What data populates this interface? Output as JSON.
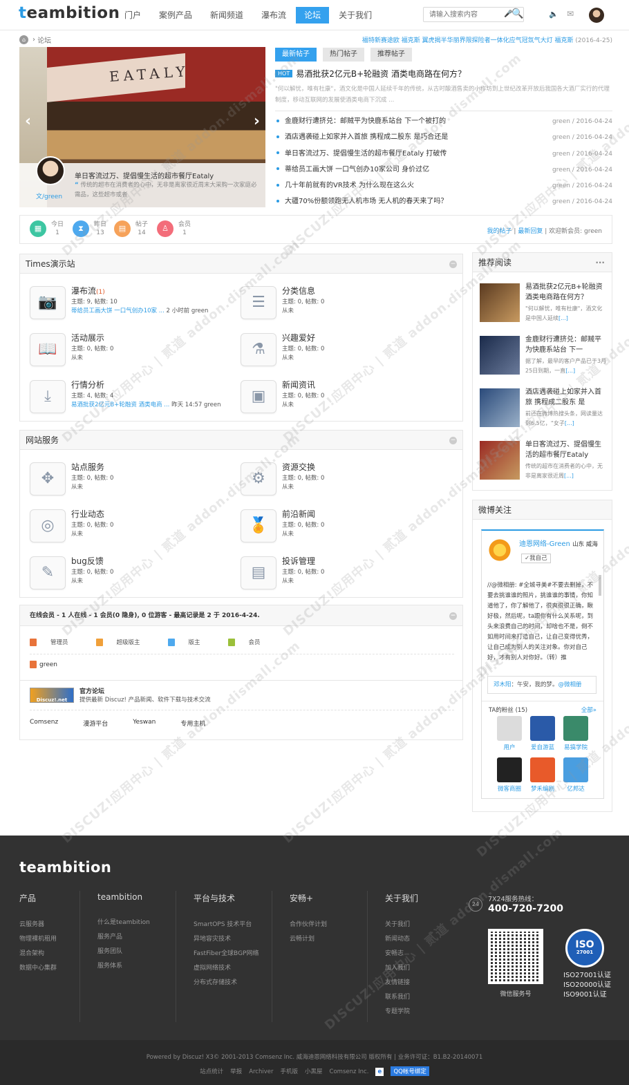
{
  "header": {
    "logo_first": "t",
    "logo_rest": "eambition",
    "nav": [
      "门户",
      "案例产品",
      "新闻频道",
      "瀑布流",
      "论坛",
      "关于我们"
    ],
    "active_nav": 4,
    "search_placeholder": "请输入搜索内容"
  },
  "breadcrumb": {
    "current": "论坛"
  },
  "ticker": {
    "text": "福特新赛途欧 福克斯 翼虎揭半华丽界限探险者一体化应气冠氛气大灯 福克斯",
    "date": "(2016-4-25)"
  },
  "slider": {
    "sign": "EATALY",
    "title": "单日客流过万、提倡慢生活的超市餐厅Eataly",
    "desc": "传统的超市在消费者的心中，无非是离家很近周末大采购一次家庭必需品，这些超市或者",
    "author": "文/green"
  },
  "post_tabs": [
    "最新帖子",
    "热门帖子",
    "推荐帖子"
  ],
  "hot_post": {
    "badge": "HOT",
    "title": "易酒批获2亿元B+轮融资 酒类电商路在何方？",
    "desc": "\"何以解忧，唯有杜康\"，酒文化是中国人延续千年的传统，从古时酿酒售卖的小作坊到上世纪改革开放后我国各大酒厂实行的代理制度，移动互联网的发展使酒类电商下沉成 ..."
  },
  "posts": [
    {
      "title": "金鹿财行遭挤兑：邮贼平为快鹿系站台 下一个被打的",
      "meta": "green / 2016-04-24"
    },
    {
      "title": "酒店遇袭碰上如家并入首旅 携程成二股东 是巧合还是",
      "meta": "green / 2016-04-24"
    },
    {
      "title": "单日客流过万、提倡慢生活的超市餐厅Eataly 打破传",
      "meta": "green / 2016-04-24"
    },
    {
      "title": "蒂给员工画大饼 一口气创办10家公司 身价过亿",
      "meta": "green / 2016-04-24"
    },
    {
      "title": "几十年前就有的VR技术 为什么现在这么火",
      "meta": "green / 2016-04-24"
    },
    {
      "title": "大疆70%份额领跑无人机市场 无人机的春天来了吗？",
      "meta": "green / 2016-04-24"
    }
  ],
  "stats": {
    "items": [
      {
        "label": "今日",
        "value": "1",
        "icon": "calendar-icon",
        "color": "#3dc6a2"
      },
      {
        "label": "昨日",
        "value": "13",
        "icon": "hourglass-icon",
        "color": "#4ea9ee"
      },
      {
        "label": "帖子",
        "value": "14",
        "icon": "post-icon",
        "color": "#f6a25a"
      },
      {
        "label": "会员",
        "value": "1",
        "icon": "member-icon",
        "color": "#f36d7a"
      }
    ],
    "my_posts": "我的帖子",
    "latest_reply": "最新回复",
    "welcome": "欢迎新会员: green"
  },
  "forum_groups": [
    {
      "title": "Times演示站",
      "forums": [
        {
          "name": "瀑布流",
          "new": "(1)",
          "stats": "主题: 9, 帖数: 10",
          "last_link": "蒂给员工画大饼 一口气创办10家 ...",
          "last_tail": " 2 小时前 green",
          "icon": "camera-icon",
          "glyph": "📷"
        },
        {
          "name": "分类信息",
          "new": "",
          "stats": "主题: 0, 帖数: 0",
          "last_link": "",
          "last_tail": "从未",
          "icon": "list-icon",
          "glyph": "☰"
        },
        {
          "name": "活动展示",
          "new": "",
          "stats": "主题: 0, 帖数: 0",
          "last_link": "",
          "last_tail": "从未",
          "icon": "book-icon",
          "glyph": "📖"
        },
        {
          "name": "兴趣爱好",
          "new": "",
          "stats": "主题: 0, 帖数: 0",
          "last_link": "",
          "last_tail": "从未",
          "icon": "trophy-icon",
          "glyph": "⚗"
        },
        {
          "name": "行情分析",
          "new": "",
          "stats": "主题: 4, 帖数: 4",
          "last_link": "易酒批获2亿元B+轮融资 酒类电商 ...",
          "last_tail": " 昨天 14:57 green",
          "icon": "chart-icon",
          "glyph": "⤓"
        },
        {
          "name": "新闻资讯",
          "new": "",
          "stats": "主题: 0, 帖数: 0",
          "last_link": "",
          "last_tail": "从未",
          "icon": "news-icon",
          "glyph": "▣"
        }
      ]
    },
    {
      "title": "网站服务",
      "forums": [
        {
          "name": "站点服务",
          "new": "",
          "stats": "主题: 0, 帖数: 0",
          "last_link": "",
          "last_tail": "从未",
          "icon": "share-icon",
          "glyph": "✥"
        },
        {
          "name": "资源交换",
          "new": "",
          "stats": "主题: 0, 帖数: 0",
          "last_link": "",
          "last_tail": "从未",
          "icon": "network-icon",
          "glyph": "⚙"
        },
        {
          "name": "行业动态",
          "new": "",
          "stats": "主题: 0, 帖数: 0",
          "last_link": "",
          "last_tail": "从未",
          "icon": "wave-icon",
          "glyph": "◎"
        },
        {
          "name": "前沿新闻",
          "new": "",
          "stats": "主题: 0, 帖数: 0",
          "last_link": "",
          "last_tail": "从未",
          "icon": "medal-icon",
          "glyph": "🏅"
        },
        {
          "name": "bug反馈",
          "new": "",
          "stats": "主题: 0, 帖数: 0",
          "last_link": "",
          "last_tail": "从未",
          "icon": "pencil-icon",
          "glyph": "✎"
        },
        {
          "name": "投诉管理",
          "new": "",
          "stats": "主题: 0, 帖数: 0",
          "last_link": "",
          "last_tail": "从未",
          "icon": "box-icon",
          "glyph": "▤"
        }
      ]
    }
  ],
  "online": {
    "header": "在线会员 - 1 人在线 - 1 会员(0 隐身), 0 位游客 - 最高记录是 2 于 2016-4-24.",
    "legend": [
      {
        "label": "管理员",
        "color": "#e8733a"
      },
      {
        "label": "超级版主",
        "color": "#f0a03a"
      },
      {
        "label": "版主",
        "color": "#4ea9ee"
      },
      {
        "label": "会员",
        "color": "#9bc03a"
      }
    ],
    "user": "green"
  },
  "links": {
    "banner": "Discuz!.net",
    "title": "官方论坛",
    "desc": "提供最新 Discuz! 产品新闻、软件下载与技术交流",
    "texts": [
      "Comsenz",
      "漫游平台",
      "Yeswan",
      "专用主机"
    ]
  },
  "recommend": {
    "title": "推荐阅读",
    "more": "···",
    "more_label": "[...]",
    "items": [
      {
        "title": "易酒批获2亿元B+轮融资 酒类电商路在何方？",
        "desc": "\"何以解忧，唯有杜康\"，酒文化是中国人延续",
        "colors": [
          "#5a3a20",
          "#c89a60"
        ]
      },
      {
        "title": "金鹿财行遭挤兑：邮贼平为快鹿系站台 下一",
        "desc": "据了解，最早的客户产品已于3月25日到期，一直",
        "colors": [
          "#1a2a4a",
          "#6a7a9a"
        ]
      },
      {
        "title": "酒店遇袭碰上如家并入首旅 携程成二股东 是",
        "desc": "前还在微博热搜头条，网读量达到6.5亿，“女子",
        "colors": [
          "#2a4a7a",
          "#9ab0c8"
        ]
      },
      {
        "title": "单日客流过万、提倡慢生活的超市餐厅Eataly",
        "desc": "传统的超市在消费者的心中，无非是离家很近周",
        "colors": [
          "#9a2a24",
          "#c69a60"
        ]
      }
    ]
  },
  "weibo": {
    "title": "微博关注",
    "user": "迪恩网络-Green",
    "location": "山东 威海",
    "follow": "✓我自己",
    "text": "//@微相册: #全城寻美#不要去删掉，不要去挑谁谁的照片，挑谁谁的事情，你知道他了，你了解他了，很爽很很正确，瞅好极，然后呢，ta跟你有什么关系呢，到头来浪费自己的时间，却啥也不是，倒不如用时间来打造自己，让自己变得优秀，让自己成为别人的关注对象。你对自己好，才有别人对你好。（转）推",
    "reply_user": "邓木阳",
    "reply_text": "：午安，我的梦。",
    "reply_at": "@微相册",
    "fans_label": "TA的粉丝",
    "fans_count": "(15)",
    "all": "全部»",
    "fans": [
      {
        "name": "用户",
        "color": "#dcdcdc"
      },
      {
        "name": "爱自游蓝",
        "color": "#2a5aa8"
      },
      {
        "name": "易搞学院",
        "color": "#3a8a6a"
      },
      {
        "name": "微客商圈",
        "color": "#222222"
      },
      {
        "name": "梦禾编剧",
        "color": "#e85a2a"
      },
      {
        "name": "亿邦达",
        "color": "#4a9ee0"
      }
    ]
  },
  "footer": {
    "logo": "teambition",
    "columns": [
      {
        "title": "产品",
        "items": [
          "云服务器",
          "物理裸机租用",
          "混合架构",
          "数据中心集群"
        ]
      },
      {
        "title": "teambition",
        "items": [
          "什么是teambition",
          "服务产品",
          "服务团队",
          "服务体系"
        ]
      },
      {
        "title": "平台与技术",
        "items": [
          "SmartOPS 技术平台",
          "异地容灾技术",
          "FastFiber全球BGP网络",
          "虚拟网络技术",
          "分布式存储技术"
        ]
      },
      {
        "title": "安畅+",
        "items": [
          "合作伙伴计划",
          "云畅计划"
        ]
      },
      {
        "title": "关于我们",
        "items": [
          "关于我们",
          "新闻动态",
          "安畅志",
          "加入我们",
          "友情链接",
          "联系我们",
          "专题学院"
        ]
      }
    ],
    "hotline_label": "7X24服务热线：",
    "hotline": "400-720-7200",
    "qr_label": "微信服务号",
    "iso_title": "ISO",
    "iso_sub": "27001",
    "certs": [
      "ISO27001认证",
      "ISO20000认证",
      "ISO9001认证"
    ]
  },
  "bottom": {
    "line1": "Powered by Discuz! X3© 2001-2013 Comsenz Inc. 威海迪恩网络科技有限公司 版权所有 | 业务许可证：B1.B2-20140071",
    "links": [
      "站点统计",
      "举报",
      "Archiver",
      "手机版",
      "小黑屋",
      "Comsenz Inc."
    ],
    "qq": "QQ帐号绑定"
  },
  "watermark": "DISCUZ!应用中心 | 贰道 addon.dismall.com"
}
